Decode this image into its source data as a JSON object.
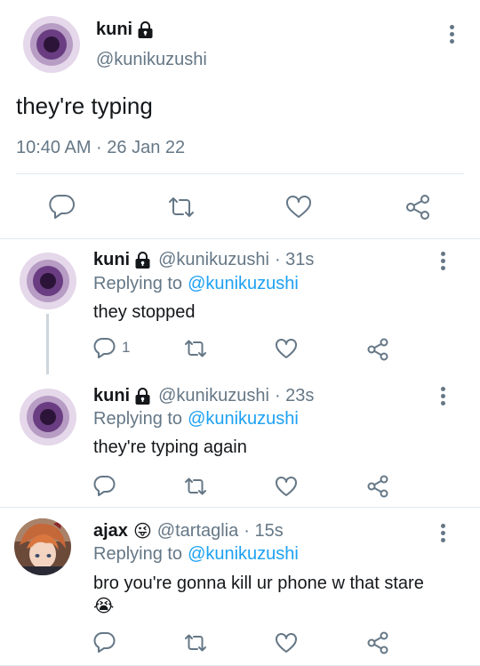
{
  "main_tweet": {
    "display_name": "kuni",
    "handle": "@kunikuzushi",
    "text": "they're typing",
    "timestamp": "10:40 AM · 26 Jan 22",
    "actions": [
      "reply-icon",
      "retweet-icon",
      "like-icon",
      "share-icon"
    ]
  },
  "replies": [
    {
      "display_name": "kuni",
      "handle": "@kunikuzushi",
      "time": "· 31s",
      "replying_prefix": "Replying to",
      "replying_to": "@kunikuzushi",
      "text": "they stopped",
      "reply_count": "1"
    },
    {
      "display_name": "kuni",
      "handle": "@kunikuzushi",
      "time": "· 23s",
      "replying_prefix": "Replying to",
      "replying_to": "@kunikuzushi",
      "text": "they're typing again",
      "reply_count": ""
    },
    {
      "display_name": "ajax",
      "emoji": "😜",
      "handle": "@tartaglia",
      "time": "· 15s",
      "replying_prefix": "Replying to",
      "replying_to": "@kunikuzushi",
      "text": "bro you're gonna kill ur phone w that stare",
      "text_emoji": "😭",
      "reply_count": ""
    }
  ],
  "colors": {
    "accent": "#1da1f2",
    "muted": "#657786",
    "text": "#14171a",
    "divider": "#e1e8ed",
    "avatar_outer": "#e5d8ea",
    "avatar_mid": "#b79cc4",
    "avatar_inner": "#6a3d82",
    "avatar_core": "#2c1438"
  }
}
